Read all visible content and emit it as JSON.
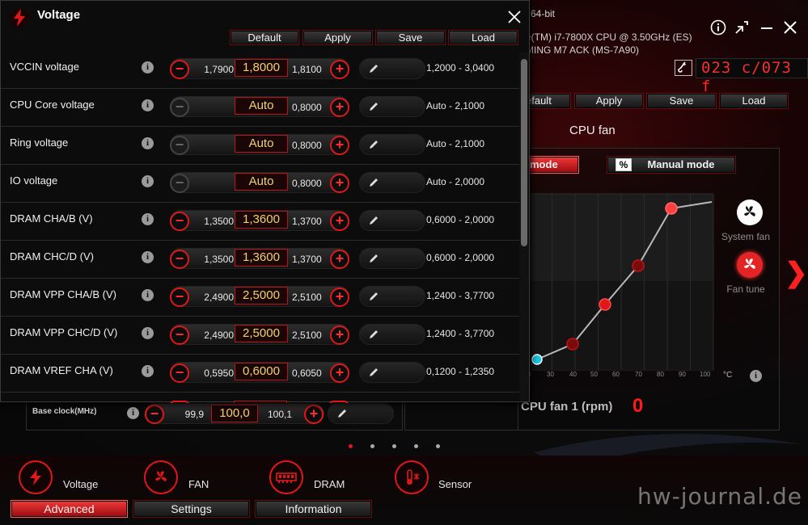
{
  "main": {
    "sys_line1": "64-bit",
    "sys_line2": "e(TM) i7-7800X CPU @ 3.50GHz (ES)",
    "sys_line3": "MING M7 ACK (MS-7A90)",
    "temp_display": "023 c/073 f",
    "toolbar": {
      "default": "efault",
      "apply": "Apply",
      "save": "Save",
      "load": "Load"
    },
    "fan_title": "CPU fan",
    "mode_auto": "mode",
    "mode_manual": "Manual mode",
    "percent_symbol": "%",
    "system_fan_label": "System fan",
    "fan_tune_label": "Fan tune",
    "unit_c": "°C",
    "x_ticks": [
      "30",
      "40",
      "50",
      "60",
      "70",
      "80",
      "90",
      "100"
    ],
    "x_partial": "0",
    "rpm_label": "CPU fan 1 (rpm)",
    "rpm_value": "0",
    "base_clock": {
      "label": "Base clock(MHz)",
      "low": "99,9",
      "current": "100,0",
      "high": "100,1"
    }
  },
  "nav": {
    "voltage": "Voltage",
    "fan": "FAN",
    "dram": "DRAM",
    "sensor": "Sensor",
    "tabs": [
      "Advanced",
      "Settings",
      "Information"
    ]
  },
  "watermark": "hw-journal.de",
  "voltage_window": {
    "title": "Voltage",
    "toolbar": {
      "default": "Default",
      "apply": "Apply",
      "save": "Save",
      "load": "Load"
    },
    "rows": [
      {
        "name": "VCCIN voltage",
        "low": "1,7900",
        "current": "1,8000",
        "high": "1,8100",
        "range": "1,2000 - 3,0400",
        "minus": true
      },
      {
        "name": "CPU Core voltage",
        "low": "",
        "current": "Auto",
        "high": "0,8000",
        "range": "Auto - 2,1000",
        "minus": false
      },
      {
        "name": "Ring voltage",
        "low": "",
        "current": "Auto",
        "high": "0,8000",
        "range": "Auto - 2,1000",
        "minus": false
      },
      {
        "name": "IO voltage",
        "low": "",
        "current": "Auto",
        "high": "0,8000",
        "range": "Auto - 2,0000",
        "minus": false
      },
      {
        "name": "DRAM CHA/B (V)",
        "low": "1,3500",
        "current": "1,3600",
        "high": "1,3700",
        "range": "0,6000 - 2,0000",
        "minus": true
      },
      {
        "name": "DRAM CHC/D (V)",
        "low": "1,3500",
        "current": "1,3600",
        "high": "1,3700",
        "range": "0,6000 - 2,0000",
        "minus": true
      },
      {
        "name": "DRAM VPP CHA/B (V)",
        "low": "2,4900",
        "current": "2,5000",
        "high": "2,5100",
        "range": "1,2400 - 3,7700",
        "minus": true
      },
      {
        "name": "DRAM VPP CHC/D (V)",
        "low": "2,4900",
        "current": "2,5000",
        "high": "2,5100",
        "range": "1,2400 - 3,7700",
        "minus": true
      },
      {
        "name": "DRAM VREF CHA (V)",
        "low": "0,5950",
        "current": "0,6000",
        "high": "0,6050",
        "range": "0,1200 - 1,2350",
        "minus": true
      }
    ]
  },
  "colors": {
    "accent": "#e01818",
    "value_text": "#f0d46a"
  }
}
